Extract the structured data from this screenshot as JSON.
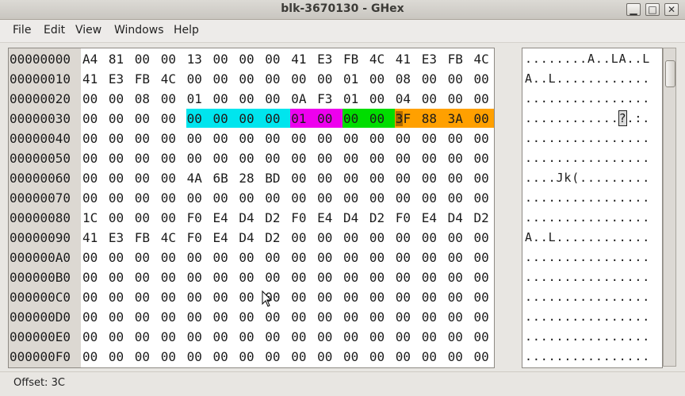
{
  "window": {
    "title": "blk-3670130 - GHex"
  },
  "menu": [
    "File",
    "Edit",
    "View",
    "Windows",
    "Help"
  ],
  "hex_rows": [
    {
      "offset": "00000000",
      "bytes": [
        "A4",
        "81",
        "00",
        "00",
        "13",
        "00",
        "00",
        "00",
        "41",
        "E3",
        "FB",
        "4C",
        "41",
        "E3",
        "FB",
        "4C"
      ],
      "ascii": "........A..LA..L"
    },
    {
      "offset": "00000010",
      "bytes": [
        "41",
        "E3",
        "FB",
        "4C",
        "00",
        "00",
        "00",
        "00",
        "00",
        "00",
        "01",
        "00",
        "08",
        "00",
        "00",
        "00"
      ],
      "ascii": "A..L............"
    },
    {
      "offset": "00000020",
      "bytes": [
        "00",
        "00",
        "08",
        "00",
        "01",
        "00",
        "00",
        "00",
        "0A",
        "F3",
        "01",
        "00",
        "04",
        "00",
        "00",
        "00"
      ],
      "ascii": "................"
    },
    {
      "offset": "00000030",
      "bytes": [
        "00",
        "00",
        "00",
        "00",
        "00",
        "00",
        "00",
        "00",
        "01",
        "00",
        "00",
        "00",
        "3F",
        "88",
        "3A",
        "00"
      ],
      "ascii": "............?.:."
    },
    {
      "offset": "00000040",
      "bytes": [
        "00",
        "00",
        "00",
        "00",
        "00",
        "00",
        "00",
        "00",
        "00",
        "00",
        "00",
        "00",
        "00",
        "00",
        "00",
        "00"
      ],
      "ascii": "................"
    },
    {
      "offset": "00000050",
      "bytes": [
        "00",
        "00",
        "00",
        "00",
        "00",
        "00",
        "00",
        "00",
        "00",
        "00",
        "00",
        "00",
        "00",
        "00",
        "00",
        "00"
      ],
      "ascii": "................"
    },
    {
      "offset": "00000060",
      "bytes": [
        "00",
        "00",
        "00",
        "00",
        "4A",
        "6B",
        "28",
        "BD",
        "00",
        "00",
        "00",
        "00",
        "00",
        "00",
        "00",
        "00"
      ],
      "ascii": "....Jk(........."
    },
    {
      "offset": "00000070",
      "bytes": [
        "00",
        "00",
        "00",
        "00",
        "00",
        "00",
        "00",
        "00",
        "00",
        "00",
        "00",
        "00",
        "00",
        "00",
        "00",
        "00"
      ],
      "ascii": "................"
    },
    {
      "offset": "00000080",
      "bytes": [
        "1C",
        "00",
        "00",
        "00",
        "F0",
        "E4",
        "D4",
        "D2",
        "F0",
        "E4",
        "D4",
        "D2",
        "F0",
        "E4",
        "D4",
        "D2"
      ],
      "ascii": "................"
    },
    {
      "offset": "00000090",
      "bytes": [
        "41",
        "E3",
        "FB",
        "4C",
        "F0",
        "E4",
        "D4",
        "D2",
        "00",
        "00",
        "00",
        "00",
        "00",
        "00",
        "00",
        "00"
      ],
      "ascii": "A..L............"
    },
    {
      "offset": "000000A0",
      "bytes": [
        "00",
        "00",
        "00",
        "00",
        "00",
        "00",
        "00",
        "00",
        "00",
        "00",
        "00",
        "00",
        "00",
        "00",
        "00",
        "00"
      ],
      "ascii": "................"
    },
    {
      "offset": "000000B0",
      "bytes": [
        "00",
        "00",
        "00",
        "00",
        "00",
        "00",
        "00",
        "00",
        "00",
        "00",
        "00",
        "00",
        "00",
        "00",
        "00",
        "00"
      ],
      "ascii": "................"
    },
    {
      "offset": "000000C0",
      "bytes": [
        "00",
        "00",
        "00",
        "00",
        "00",
        "00",
        "00",
        "00",
        "00",
        "00",
        "00",
        "00",
        "00",
        "00",
        "00",
        "00"
      ],
      "ascii": "................"
    },
    {
      "offset": "000000D0",
      "bytes": [
        "00",
        "00",
        "00",
        "00",
        "00",
        "00",
        "00",
        "00",
        "00",
        "00",
        "00",
        "00",
        "00",
        "00",
        "00",
        "00"
      ],
      "ascii": "................"
    },
    {
      "offset": "000000E0",
      "bytes": [
        "00",
        "00",
        "00",
        "00",
        "00",
        "00",
        "00",
        "00",
        "00",
        "00",
        "00",
        "00",
        "00",
        "00",
        "00",
        "00"
      ],
      "ascii": "................"
    },
    {
      "offset": "000000F0",
      "bytes": [
        "00",
        "00",
        "00",
        "00",
        "00",
        "00",
        "00",
        "00",
        "00",
        "00",
        "00",
        "00",
        "00",
        "00",
        "00",
        "00"
      ],
      "ascii": "................"
    }
  ],
  "highlights": [
    {
      "row": 3,
      "from": 4,
      "to": 7,
      "color": "#00e5ee"
    },
    {
      "row": 3,
      "from": 8,
      "to": 9,
      "color": "#ee00ee"
    },
    {
      "row": 3,
      "from": 10,
      "to": 11,
      "color": "#00dd00"
    },
    {
      "row": 3,
      "from": 12,
      "to": 15,
      "color": "#ffa000"
    }
  ],
  "cursor": {
    "row": 3,
    "byte": 12,
    "ascii_char": 12,
    "color": "#b06a00"
  },
  "status": {
    "offset_text": "Offset: 3C"
  }
}
